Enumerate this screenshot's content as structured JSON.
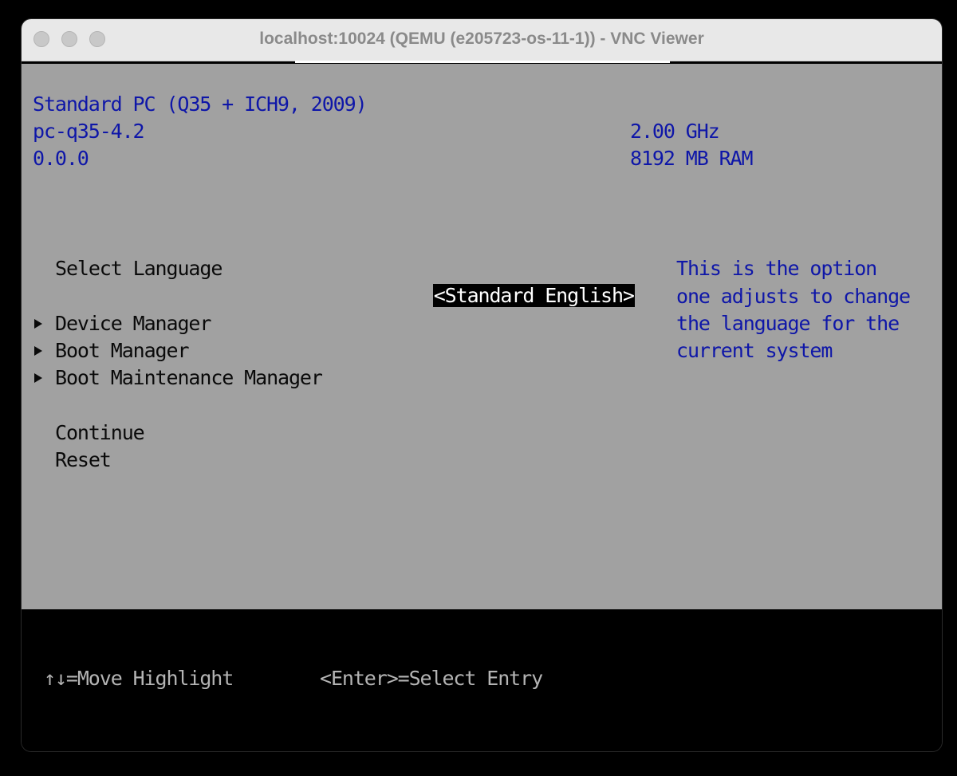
{
  "window": {
    "title": "localhost:10024 (QEMU (e205723-os-11-1)) - VNC Viewer"
  },
  "system_info": {
    "machine": "Standard PC (Q35 + ICH9, 2009)",
    "version": "pc-q35-4.2",
    "firmware": "0.0.0",
    "cpu_speed": "2.00 GHz",
    "memory": "8192 MB RAM"
  },
  "menu": {
    "select_language_label": "Select Language",
    "select_language_value": "<Standard English>",
    "items": [
      {
        "label": "Device Manager"
      },
      {
        "label": "Boot Manager"
      },
      {
        "label": "Boot Maintenance Manager"
      }
    ],
    "continue_label": "Continue",
    "reset_label": "Reset"
  },
  "help": {
    "lines": [
      "This is the option",
      "one adjusts to change",
      "the language for the",
      "current system"
    ]
  },
  "status": {
    "move_hint": "↑↓=Move Highlight",
    "enter_hint": "<Enter>=Select Entry"
  },
  "colors": {
    "screen_bg": "#a1a1a1",
    "info_text": "#0e16a8",
    "menu_text": "#0a0a0a",
    "status_bg": "#000000",
    "status_text": "#b4b4b4"
  }
}
